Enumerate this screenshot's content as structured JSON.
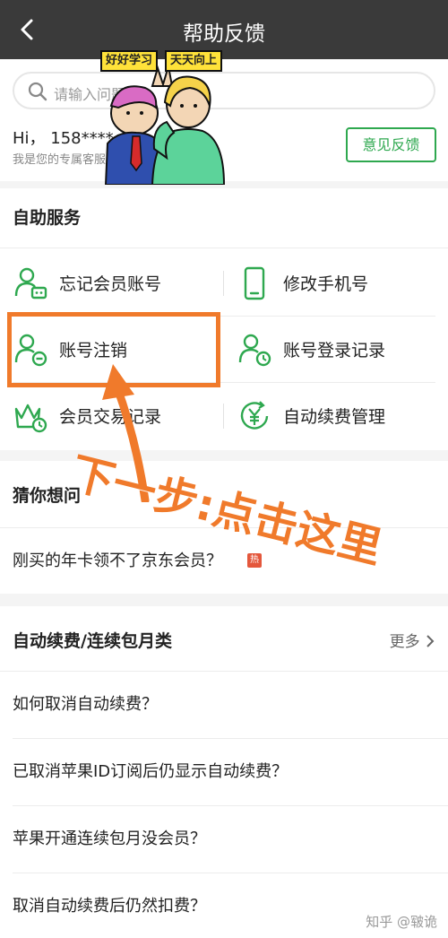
{
  "topbar": {
    "title": "帮助反馈"
  },
  "header": {
    "search_placeholder": "请输入问题",
    "greeting": "Hi， 158****",
    "subtext": "我是您的专属客服，很高兴为您服务~",
    "feedback_button": "意见反馈",
    "sticker_tags": [
      "好好学习",
      "天天向上"
    ]
  },
  "self_service": {
    "title": "自助服务",
    "items": [
      {
        "label": "忘记会员账号",
        "icon": "user-card-icon"
      },
      {
        "label": "修改手机号",
        "icon": "phone-icon"
      },
      {
        "label": "账号注销",
        "icon": "user-minus-icon"
      },
      {
        "label": "账号登录记录",
        "icon": "user-clock-icon"
      },
      {
        "label": "会员交易记录",
        "icon": "crown-clock-icon"
      },
      {
        "label": "自动续费管理",
        "icon": "yen-cycle-icon"
      }
    ]
  },
  "guess": {
    "title": "猜你想问",
    "question": "刚买的年卡领不了京东会员？",
    "hot_badge": "热"
  },
  "auto_renew": {
    "title": "自动续费/连续包月类",
    "more": "更多",
    "questions": [
      "如何取消自动续费？",
      "已取消苹果ID订阅后仍显示自动续费？",
      "苹果开通连续包月没会员？",
      "取消自动续费后仍然扣费？"
    ]
  },
  "annotation": {
    "text": "下一步:点击这里"
  },
  "watermark": "知乎 @皲诡",
  "colors": {
    "accent": "#2ea84f",
    "annotation": "#f07a2b",
    "topbar": "#3a3a3a"
  }
}
